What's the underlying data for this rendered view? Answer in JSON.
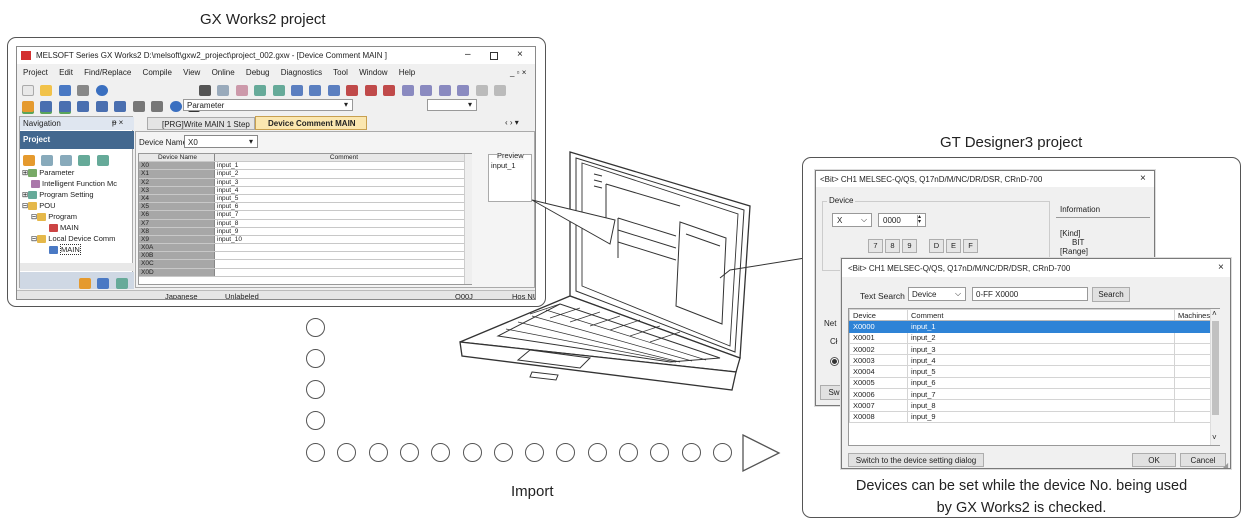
{
  "gx": {
    "panel_title": "GX Works2 project",
    "window_title": "MELSOFT Series GX Works2 D:\\melsoft\\gxw2_project\\project_002.gxw - [Device Comment MAIN ]",
    "menu": [
      "Project",
      "Edit",
      "Find/Replace",
      "Compile",
      "View",
      "Online",
      "Debug",
      "Diagnostics",
      "Tool",
      "Window",
      "Help"
    ],
    "toolbar_combo": "Parameter",
    "nav_title": "Navigation",
    "nav_section": "Project",
    "tree": [
      "Parameter",
      "Intelligent Function Mc",
      "Program Setting",
      "POU",
      "Program",
      "MAIN",
      "Local Device Comm",
      "MAIN"
    ],
    "tabs": [
      "[PRG]Write MAIN 1 Step",
      "Device Comment MAIN"
    ],
    "device_name_label": "Device Name",
    "device_name_value": "X0",
    "col_device": "Device Name",
    "col_comment": "Comment",
    "preview_label": "Preview",
    "preview_value": "input_1",
    "rows": [
      {
        "d": "X0",
        "c": "input_1"
      },
      {
        "d": "X1",
        "c": "input_2"
      },
      {
        "d": "X2",
        "c": "input_3"
      },
      {
        "d": "X3",
        "c": "input_4"
      },
      {
        "d": "X4",
        "c": "input_5"
      },
      {
        "d": "X5",
        "c": "input_6"
      },
      {
        "d": "X6",
        "c": "input_7"
      },
      {
        "d": "X7",
        "c": "input_8"
      },
      {
        "d": "X8",
        "c": "input_9"
      },
      {
        "d": "X9",
        "c": "input_10"
      },
      {
        "d": "X0A",
        "c": ""
      },
      {
        "d": "X0B",
        "c": ""
      },
      {
        "d": "X0C",
        "c": ""
      },
      {
        "d": "X0D",
        "c": ""
      }
    ],
    "status": [
      "Japanese",
      "Unlabeled",
      "Q00J",
      "Hos NU"
    ]
  },
  "gt": {
    "panel_title": "GT Designer3 project",
    "dlg1_title": "<Bit> CH1 MELSEC-Q/QS, Q17nD/M/NC/DR/DSR, CRnD-700",
    "device_label": "Device",
    "device_type": "X",
    "device_no": "0000",
    "keys": [
      "7",
      "8",
      "9",
      "D",
      "E",
      "F"
    ],
    "info_label": "Information",
    "info_kind": "[Kind]",
    "info_bit": "BIT",
    "info_range": "[Range]",
    "side_labels": [
      "Net",
      "Cł",
      "Sw"
    ],
    "dlg2_title": "<Bit> CH1 MELSEC-Q/QS, Q17nD/M/NC/DR/DSR, CRnD-700",
    "text_search_label": "Text Search",
    "search_combo": "Device",
    "search_value": "0-FF X0000",
    "search_button": "Search",
    "col_device": "Device",
    "col_comment": "Comment",
    "col_machines": "Machines",
    "rows": [
      {
        "d": "X0000",
        "c": "input_1"
      },
      {
        "d": "X0001",
        "c": "input_2"
      },
      {
        "d": "X0002",
        "c": "input_3"
      },
      {
        "d": "X0003",
        "c": "input_4"
      },
      {
        "d": "X0004",
        "c": "input_5"
      },
      {
        "d": "X0005",
        "c": "input_6"
      },
      {
        "d": "X0006",
        "c": "input_7"
      },
      {
        "d": "X0007",
        "c": "input_8"
      },
      {
        "d": "X0008",
        "c": "input_9"
      }
    ],
    "switch_button": "Switch to the device setting dialog",
    "ok_button": "OK",
    "cancel_button": "Cancel",
    "caption_line1": "Devices can be set while the device No. being used",
    "caption_line2": "by GX Works2 is checked."
  },
  "flow": {
    "label": "Import"
  }
}
